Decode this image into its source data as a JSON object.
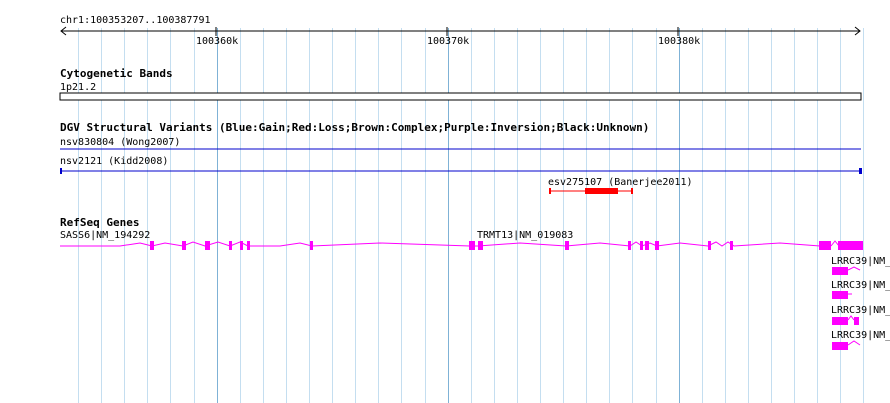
{
  "region": {
    "label": "chr1:100353207..100387791"
  },
  "ruler": {
    "ticks": [
      {
        "label": "100360k"
      },
      {
        "label": "100370k"
      },
      {
        "label": "100380k"
      }
    ]
  },
  "tracks": {
    "cytoband": {
      "title": "Cytogenetic Bands",
      "band_label": "1p21.2"
    },
    "dgv": {
      "title": "DGV Structural Variants (Blue:Gain;Red:Loss;Brown:Complex;Purple:Inversion;Black:Unknown)",
      "features": [
        {
          "label": "nsv830804 (Wong2007)",
          "color": "#0000cc"
        },
        {
          "label": "nsv2121 (Kidd2008)",
          "color": "#0000cc"
        },
        {
          "label": "esv275107 (Banerjee2011)",
          "color": "#ff0000"
        }
      ]
    },
    "refseq": {
      "title": "RefSeq Genes",
      "color": "#ff00ff",
      "genes": [
        {
          "label": "SASS6|NM_194292"
        },
        {
          "label": "TRMT13|NM_019083"
        },
        {
          "label": "LRRC39|NM_"
        },
        {
          "label": "LRRC39|NM_"
        },
        {
          "label": "LRRC39|NM_"
        },
        {
          "label": "LRRC39|NM_"
        }
      ]
    }
  },
  "colors": {
    "grid_major": "#7fb2d6",
    "grid_minor": "#c4def0",
    "loss": "#ff0000",
    "gain": "#0000cc",
    "gene": "#ff00ff"
  }
}
